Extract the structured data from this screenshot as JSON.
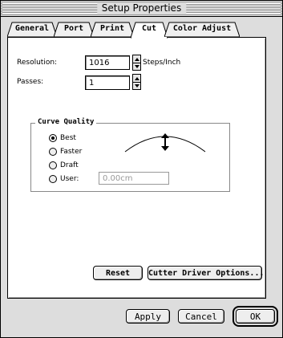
{
  "window": {
    "title": "Setup Properties"
  },
  "tabs": [
    {
      "label": "General",
      "active": false
    },
    {
      "label": "Port",
      "active": false
    },
    {
      "label": "Print",
      "active": false
    },
    {
      "label": "Cut",
      "active": true
    },
    {
      "label": "Color Adjust",
      "active": false
    }
  ],
  "cut": {
    "resolution_label": "Resolution:",
    "resolution_value": "1016",
    "resolution_unit": "Steps/Inch",
    "passes_label": "Passes:",
    "passes_value": "1",
    "curve_quality": {
      "title": "Curve Quality",
      "options": [
        {
          "label": "Best",
          "selected": true
        },
        {
          "label": "Faster",
          "selected": false
        },
        {
          "label": "Draft",
          "selected": false
        },
        {
          "label": "User:",
          "selected": false
        }
      ],
      "user_value": "0.00cm"
    },
    "reset_label": "Reset",
    "driver_options_label": "Cutter Driver Options..."
  },
  "footer": {
    "apply_label": "Apply",
    "cancel_label": "Cancel",
    "ok_label": "OK"
  }
}
